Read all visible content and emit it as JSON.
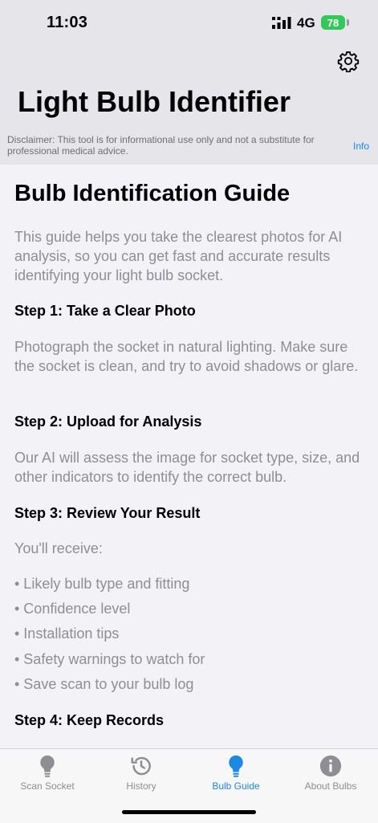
{
  "status_bar": {
    "time": "11:03",
    "network": "4G",
    "battery": "78"
  },
  "header": {
    "title": "Light Bulb Identifier",
    "disclaimer": "Disclaimer: This tool is for informational use only and not a substitute for professional medical advice.",
    "info_link": "Info"
  },
  "guide": {
    "title": "Bulb Identification Guide",
    "intro": "This guide helps you take the clearest photos for AI analysis, so you can get fast and accurate results identifying your light bulb socket.",
    "step1_title": "Step 1: Take a Clear Photo",
    "step1_text": "Photograph the socket in natural lighting. Make sure the socket is clean, and try to avoid shadows or glare.",
    "step2_title": "Step 2: Upload for Analysis",
    "step2_text": "Our AI will assess the image for socket type, size, and other indicators to identify the correct bulb.",
    "step3_title": "Step 3: Review Your Result",
    "step3_text": "You'll receive:",
    "bullets": [
      "• Likely bulb type and fitting",
      "• Confidence level",
      "• Installation tips",
      "• Safety warnings to watch for",
      "• Save scan to your bulb log"
    ],
    "step4_title": "Step 4: Keep Records"
  },
  "tabs": [
    {
      "label": "Scan Socket",
      "icon": "lightbulb-icon"
    },
    {
      "label": "History",
      "icon": "history-icon"
    },
    {
      "label": "Bulb Guide",
      "icon": "lightbulb-icon"
    },
    {
      "label": "About Bulbs",
      "icon": "info-icon"
    }
  ],
  "colors": {
    "accent": "#1e88e5",
    "inactive": "#8e8e93",
    "battery": "#34c759"
  }
}
